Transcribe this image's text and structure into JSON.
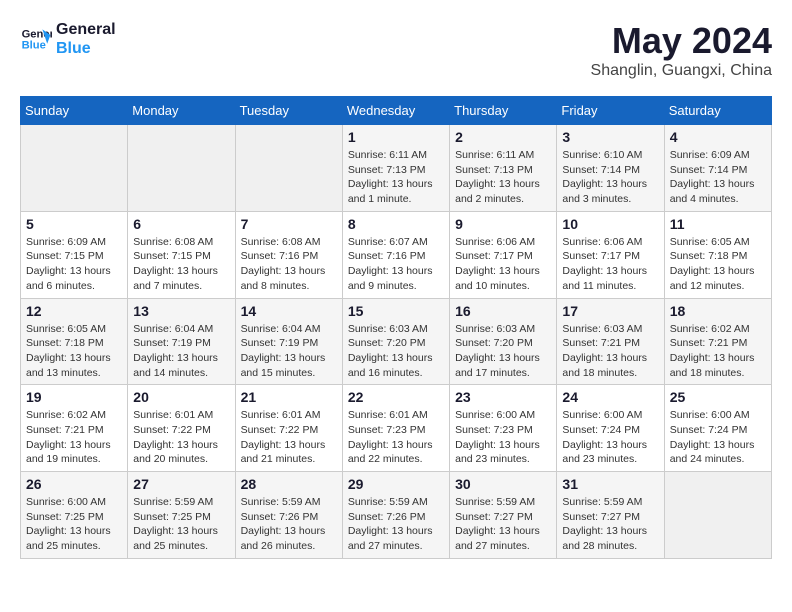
{
  "header": {
    "logo_line1": "General",
    "logo_line2": "Blue",
    "main_title": "May 2024",
    "subtitle": "Shanglin, Guangxi, China"
  },
  "weekdays": [
    "Sunday",
    "Monday",
    "Tuesday",
    "Wednesday",
    "Thursday",
    "Friday",
    "Saturday"
  ],
  "weeks": [
    [
      {
        "day": "",
        "info": ""
      },
      {
        "day": "",
        "info": ""
      },
      {
        "day": "",
        "info": ""
      },
      {
        "day": "1",
        "info": "Sunrise: 6:11 AM\nSunset: 7:13 PM\nDaylight: 13 hours and 1 minute."
      },
      {
        "day": "2",
        "info": "Sunrise: 6:11 AM\nSunset: 7:13 PM\nDaylight: 13 hours and 2 minutes."
      },
      {
        "day": "3",
        "info": "Sunrise: 6:10 AM\nSunset: 7:14 PM\nDaylight: 13 hours and 3 minutes."
      },
      {
        "day": "4",
        "info": "Sunrise: 6:09 AM\nSunset: 7:14 PM\nDaylight: 13 hours and 4 minutes."
      }
    ],
    [
      {
        "day": "5",
        "info": "Sunrise: 6:09 AM\nSunset: 7:15 PM\nDaylight: 13 hours and 6 minutes."
      },
      {
        "day": "6",
        "info": "Sunrise: 6:08 AM\nSunset: 7:15 PM\nDaylight: 13 hours and 7 minutes."
      },
      {
        "day": "7",
        "info": "Sunrise: 6:08 AM\nSunset: 7:16 PM\nDaylight: 13 hours and 8 minutes."
      },
      {
        "day": "8",
        "info": "Sunrise: 6:07 AM\nSunset: 7:16 PM\nDaylight: 13 hours and 9 minutes."
      },
      {
        "day": "9",
        "info": "Sunrise: 6:06 AM\nSunset: 7:17 PM\nDaylight: 13 hours and 10 minutes."
      },
      {
        "day": "10",
        "info": "Sunrise: 6:06 AM\nSunset: 7:17 PM\nDaylight: 13 hours and 11 minutes."
      },
      {
        "day": "11",
        "info": "Sunrise: 6:05 AM\nSunset: 7:18 PM\nDaylight: 13 hours and 12 minutes."
      }
    ],
    [
      {
        "day": "12",
        "info": "Sunrise: 6:05 AM\nSunset: 7:18 PM\nDaylight: 13 hours and 13 minutes."
      },
      {
        "day": "13",
        "info": "Sunrise: 6:04 AM\nSunset: 7:19 PM\nDaylight: 13 hours and 14 minutes."
      },
      {
        "day": "14",
        "info": "Sunrise: 6:04 AM\nSunset: 7:19 PM\nDaylight: 13 hours and 15 minutes."
      },
      {
        "day": "15",
        "info": "Sunrise: 6:03 AM\nSunset: 7:20 PM\nDaylight: 13 hours and 16 minutes."
      },
      {
        "day": "16",
        "info": "Sunrise: 6:03 AM\nSunset: 7:20 PM\nDaylight: 13 hours and 17 minutes."
      },
      {
        "day": "17",
        "info": "Sunrise: 6:03 AM\nSunset: 7:21 PM\nDaylight: 13 hours and 18 minutes."
      },
      {
        "day": "18",
        "info": "Sunrise: 6:02 AM\nSunset: 7:21 PM\nDaylight: 13 hours and 18 minutes."
      }
    ],
    [
      {
        "day": "19",
        "info": "Sunrise: 6:02 AM\nSunset: 7:21 PM\nDaylight: 13 hours and 19 minutes."
      },
      {
        "day": "20",
        "info": "Sunrise: 6:01 AM\nSunset: 7:22 PM\nDaylight: 13 hours and 20 minutes."
      },
      {
        "day": "21",
        "info": "Sunrise: 6:01 AM\nSunset: 7:22 PM\nDaylight: 13 hours and 21 minutes."
      },
      {
        "day": "22",
        "info": "Sunrise: 6:01 AM\nSunset: 7:23 PM\nDaylight: 13 hours and 22 minutes."
      },
      {
        "day": "23",
        "info": "Sunrise: 6:00 AM\nSunset: 7:23 PM\nDaylight: 13 hours and 23 minutes."
      },
      {
        "day": "24",
        "info": "Sunrise: 6:00 AM\nSunset: 7:24 PM\nDaylight: 13 hours and 23 minutes."
      },
      {
        "day": "25",
        "info": "Sunrise: 6:00 AM\nSunset: 7:24 PM\nDaylight: 13 hours and 24 minutes."
      }
    ],
    [
      {
        "day": "26",
        "info": "Sunrise: 6:00 AM\nSunset: 7:25 PM\nDaylight: 13 hours and 25 minutes."
      },
      {
        "day": "27",
        "info": "Sunrise: 5:59 AM\nSunset: 7:25 PM\nDaylight: 13 hours and 25 minutes."
      },
      {
        "day": "28",
        "info": "Sunrise: 5:59 AM\nSunset: 7:26 PM\nDaylight: 13 hours and 26 minutes."
      },
      {
        "day": "29",
        "info": "Sunrise: 5:59 AM\nSunset: 7:26 PM\nDaylight: 13 hours and 27 minutes."
      },
      {
        "day": "30",
        "info": "Sunrise: 5:59 AM\nSunset: 7:27 PM\nDaylight: 13 hours and 27 minutes."
      },
      {
        "day": "31",
        "info": "Sunrise: 5:59 AM\nSunset: 7:27 PM\nDaylight: 13 hours and 28 minutes."
      },
      {
        "day": "",
        "info": ""
      }
    ]
  ]
}
